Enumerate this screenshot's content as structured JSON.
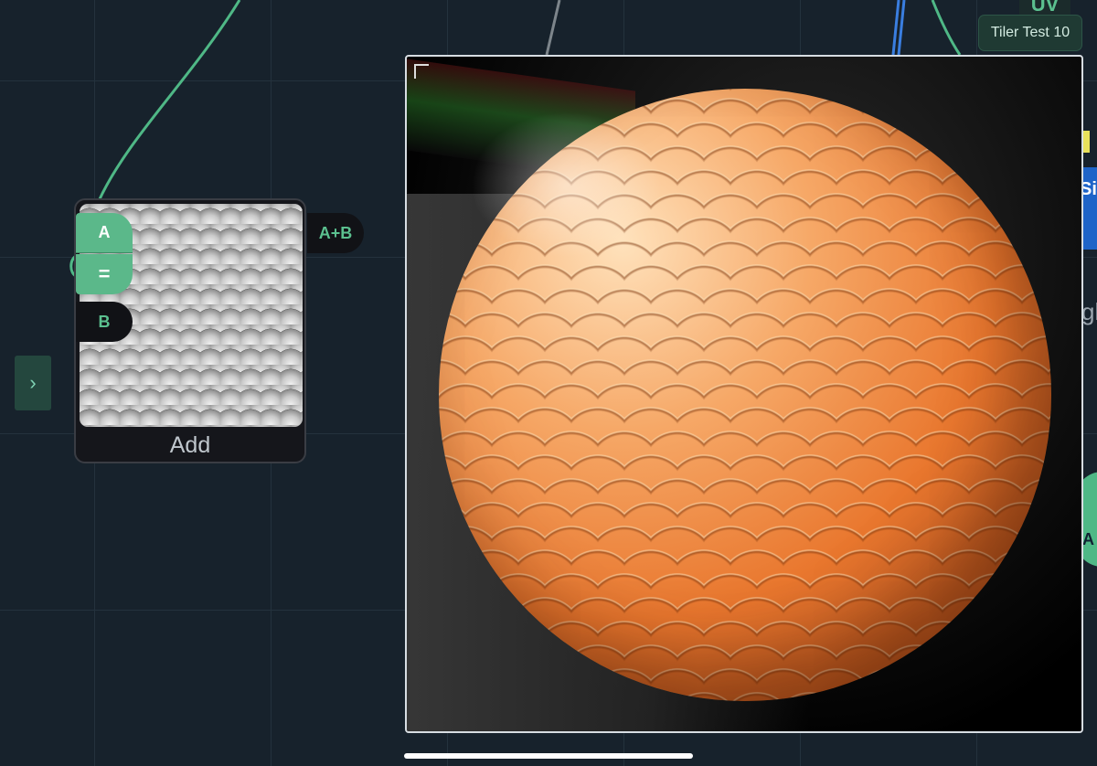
{
  "canvas": {
    "sidebar_toggle": "›"
  },
  "node": {
    "title": "Add",
    "inputs": {
      "a": "A",
      "operator": "=",
      "b": "B"
    },
    "output": "A+B"
  },
  "right_edge": {
    "uv_label": "UV",
    "blue_panel_fragment": "Si",
    "gray_fragment": "gh",
    "green_fragment": "A"
  },
  "viewer": {
    "badge": "Tiler Test 10"
  },
  "colors": {
    "background": "#17222c",
    "accent_green": "#5bb88a",
    "wire_green": "#4fb886",
    "node_bg": "#15161b",
    "blue_panel": "#1e64c8"
  }
}
